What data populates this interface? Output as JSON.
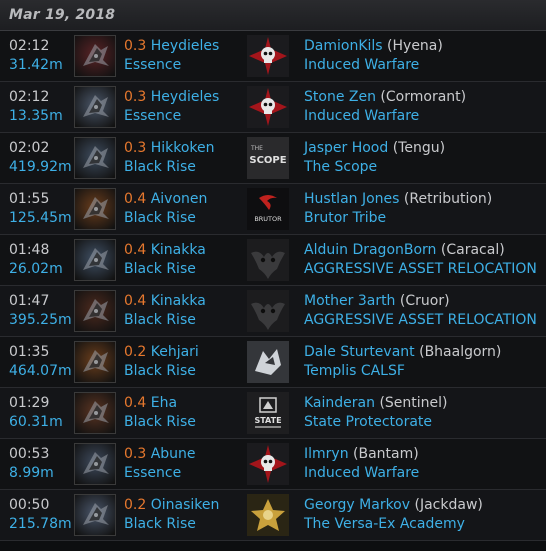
{
  "header": {
    "date": "Mar 19, 2018"
  },
  "kills": [
    {
      "time": "02:12",
      "distance": "31.42m",
      "security": "0.3",
      "system": "Heydieles",
      "region": "Essence",
      "pilot": "DamionKils",
      "ship": "(Hyena)",
      "corp": "Induced Warfare",
      "ship_icon": "ship-icon-hyena",
      "corp_icon": "induced-warfare-logo"
    },
    {
      "time": "02:12",
      "distance": "13.35m",
      "security": "0.3",
      "system": "Heydieles",
      "region": "Essence",
      "pilot": "Stone Zen",
      "ship": "(Cormorant)",
      "corp": "Induced Warfare",
      "ship_icon": "ship-icon-cormorant",
      "corp_icon": "induced-warfare-logo"
    },
    {
      "time": "02:02",
      "distance": "419.92m",
      "security": "0.3",
      "system": "Hikkoken",
      "region": "Black Rise",
      "pilot": "Jasper Hood",
      "ship": "(Tengu)",
      "corp": "The Scope",
      "ship_icon": "ship-icon-tengu",
      "corp_icon": "the-scope-logo"
    },
    {
      "time": "01:55",
      "distance": "125.45m",
      "security": "0.4",
      "system": "Aivonen",
      "region": "Black Rise",
      "pilot": "Hustlan Jones",
      "ship": "(Retribution)",
      "corp": "Brutor Tribe",
      "ship_icon": "ship-icon-retribution",
      "corp_icon": "brutor-logo"
    },
    {
      "time": "01:48",
      "distance": "26.02m",
      "security": "0.4",
      "system": "Kinakka",
      "region": "Black Rise",
      "pilot": "Alduin DragonBorn",
      "ship": "(Caracal)",
      "corp": "AGGRESSIVE ASSET RELOCATION",
      "ship_icon": "ship-icon-caracal",
      "corp_icon": "aar-logo"
    },
    {
      "time": "01:47",
      "distance": "395.25m",
      "security": "0.4",
      "system": "Kinakka",
      "region": "Black Rise",
      "pilot": "Mother 3arth",
      "ship": "(Cruor)",
      "corp": "AGGRESSIVE ASSET RELOCATION",
      "ship_icon": "ship-icon-cruor",
      "corp_icon": "aar-logo"
    },
    {
      "time": "01:35",
      "distance": "464.07m",
      "security": "0.2",
      "system": "Kehjari",
      "region": "Black Rise",
      "pilot": "Dale Sturtevant",
      "ship": "(Bhaalgorn)",
      "corp": "Templis CALSF",
      "ship_icon": "ship-icon-bhaalgorn",
      "corp_icon": "templis-logo"
    },
    {
      "time": "01:29",
      "distance": "60.31m",
      "security": "0.4",
      "system": "Eha",
      "region": "Black Rise",
      "pilot": "Kainderan",
      "ship": "(Sentinel)",
      "corp": "State Protectorate",
      "ship_icon": "ship-icon-sentinel",
      "corp_icon": "state-protectorate-logo"
    },
    {
      "time": "00:53",
      "distance": "8.99m",
      "security": "0.3",
      "system": "Abune",
      "region": "Essence",
      "pilot": "Ilmryn",
      "ship": "(Bantam)",
      "corp": "Induced Warfare",
      "ship_icon": "ship-icon-bantam",
      "corp_icon": "induced-warfare-logo"
    },
    {
      "time": "00:50",
      "distance": "215.78m",
      "security": "0.2",
      "system": "Oinasiken",
      "region": "Black Rise",
      "pilot": "Georgy Markov",
      "ship": "(Jackdaw)",
      "corp": "The Versa-Ex Academy",
      "ship_icon": "ship-icon-jackdaw",
      "corp_icon": "versa-ex-logo"
    }
  ],
  "logo_text": {
    "scope": "SCOPE",
    "brutor": "BRUTOR",
    "state": "STATE"
  },
  "colors": {
    "link": "#3eb0e6",
    "security": "#e6782e",
    "text": "#c9cacd",
    "background": "#111214"
  }
}
